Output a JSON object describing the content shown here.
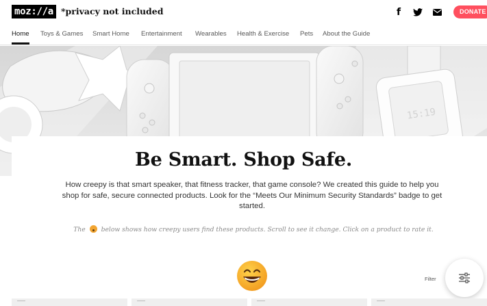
{
  "header": {
    "logo_text": "moz://a",
    "site_title": "*privacy not included",
    "social_icons": [
      "facebook-icon",
      "twitter-icon",
      "email-icon"
    ],
    "donate_label": "DONATE",
    "donate_color": "#ff4f5e"
  },
  "nav": {
    "items": [
      {
        "label": "Home",
        "active": true
      },
      {
        "label": "Toys & Games"
      },
      {
        "label": "Smart Home"
      },
      {
        "label": "Entertainment"
      },
      {
        "label": "Wearables"
      },
      {
        "label": "Health & Exercise"
      },
      {
        "label": "Pets"
      },
      {
        "label": "About the Guide"
      }
    ]
  },
  "hero": {
    "watch_time": "15:19"
  },
  "main": {
    "headline": "Be Smart. Shop Safe.",
    "intro": "How creepy is that smart speaker, that fitness tracker, that game console? We created this guide to help you shop for safe, secure connected products. Look for the “Meets Our Minimum Security Standards” badge to get started.",
    "note_prefix": "The",
    "note_suffix": "below shows how creepy users find these products. Scroll to see it change. Click on a product to rate it.",
    "filter_label": "Filter"
  }
}
